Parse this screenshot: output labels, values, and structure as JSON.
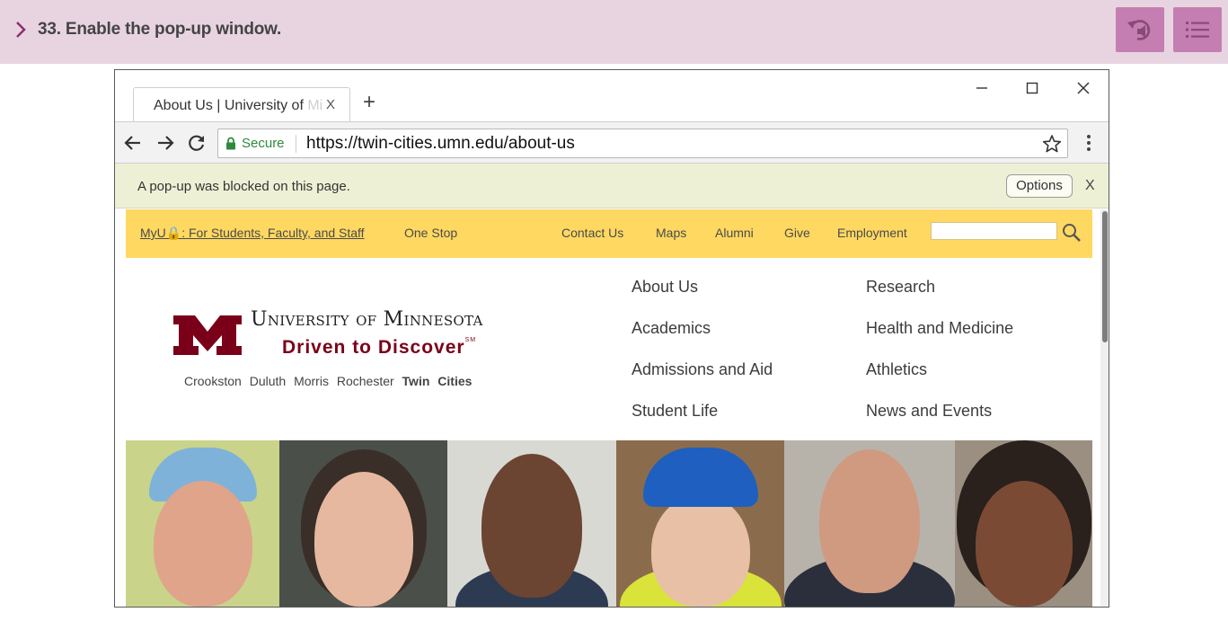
{
  "instruction": {
    "text": "33. Enable the pop-up window.",
    "colors": {
      "bar": "#e8d4e1",
      "button": "#c47eb1",
      "chevron": "#8b2f6f"
    },
    "buttons": [
      {
        "icon": "replay-audio-icon"
      },
      {
        "icon": "list-menu-icon"
      }
    ]
  },
  "browser": {
    "tab": {
      "title": "About Us | University of ",
      "title_faded": "Mi",
      "close": "X"
    },
    "new_tab": "+",
    "omnibox": {
      "secure_label": "Secure",
      "url": "https://twin-cities.umn.edu/about-us"
    },
    "popup_bar": {
      "message": "A pop-up was blocked on this page.",
      "options_label": "Options",
      "close": "X"
    }
  },
  "site": {
    "top_links": {
      "myu": "MyU🔒: For Students, Faculty, and Staff",
      "one_stop": "One Stop",
      "contact": "Contact Us",
      "maps": "Maps",
      "alumni": "Alumni",
      "give": "Give",
      "employment": "Employment"
    },
    "logo": {
      "name": "University of Minnesota",
      "tagline": "Driven to Discover",
      "tagline_mark": "SM",
      "campuses": [
        "Crookston",
        "Duluth",
        "Morris",
        "Rochester"
      ],
      "current_campus": "Twin Cities"
    },
    "menu": {
      "about": "About Us",
      "academics": "Academics",
      "admissions": "Admissions and Aid",
      "student_life": "Student Life",
      "research": "Research",
      "health": "Health and Medicine",
      "athletics": "Athletics",
      "news": "News and Events"
    },
    "colors": {
      "gold": "#ffd862",
      "maroon": "#7a0019"
    }
  }
}
